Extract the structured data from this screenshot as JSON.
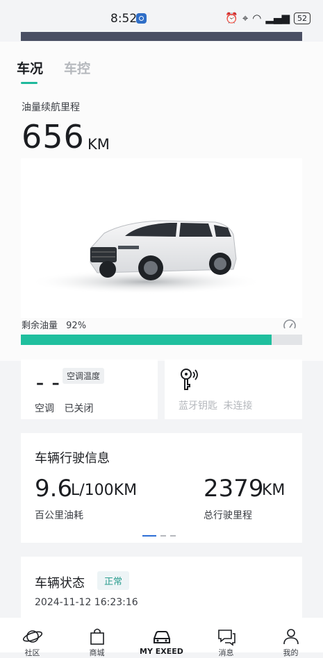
{
  "status_bar": {
    "time": "8:52",
    "battery": "52"
  },
  "tabs": [
    {
      "label": "车况",
      "active": true
    },
    {
      "label": "车控",
      "active": false
    }
  ],
  "range": {
    "label": "油量续航里程",
    "value": "656",
    "unit": "KM"
  },
  "fuel": {
    "label": "剩余油量",
    "percent_text": "92%",
    "level": 0.92
  },
  "ac": {
    "value": "– –",
    "temp_tag": "空调温度",
    "label": "空调",
    "state": "已关闭"
  },
  "bluetooth": {
    "label": "蓝牙钥匙",
    "state": "未连接"
  },
  "drive_info": {
    "title": "车辆行驶信息",
    "consumption": {
      "value": "9.6",
      "unit": "L/100KM",
      "label": "百公里油耗"
    },
    "mileage": {
      "value": "2379",
      "unit": "KM",
      "label": "总行驶里程"
    }
  },
  "vehicle_status": {
    "title": "车辆状态",
    "badge": "正常",
    "time": "2024-11-12 16:23:16"
  },
  "nav": [
    {
      "label": "社区",
      "icon": "planet-icon"
    },
    {
      "label": "商城",
      "icon": "shopping-bag-icon"
    },
    {
      "label": "MY EXEED",
      "icon": "car-icon",
      "active": true
    },
    {
      "label": "消息",
      "icon": "message-icon"
    },
    {
      "label": "我的",
      "icon": "user-icon"
    }
  ],
  "colors": {
    "accent": "#1fbf9e",
    "dark_strip": "#4a4f63",
    "dot_active": "#2c6ed6"
  }
}
